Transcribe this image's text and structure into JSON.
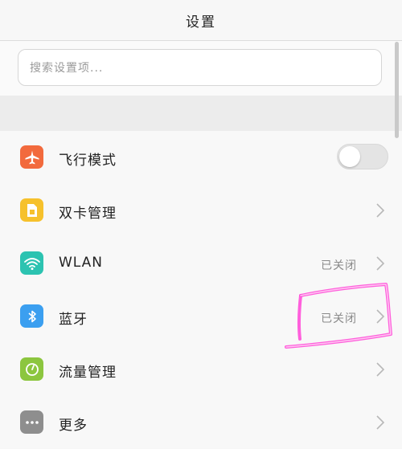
{
  "header": {
    "title": "设置"
  },
  "search": {
    "placeholder": "搜索设置项..."
  },
  "colors": {
    "airplane": "#f26a3d",
    "dual_sim": "#f6c12c",
    "wlan": "#2cc3b1",
    "bluetooth": "#3b9ff0",
    "data_usage": "#8cc63f",
    "more": "#8e8e8e",
    "annotation": "#ff4fd8"
  },
  "settings": {
    "items": [
      {
        "label": "飞行模式",
        "icon": "airplane-icon",
        "control": "toggle",
        "toggle_on": false
      },
      {
        "label": "双卡管理",
        "icon": "sim-card-icon",
        "control": "chevron"
      },
      {
        "label": "WLAN",
        "icon": "wifi-icon",
        "value": "已关闭",
        "control": "chevron"
      },
      {
        "label": "蓝牙",
        "icon": "bluetooth-icon",
        "value": "已关闭",
        "control": "chevron"
      },
      {
        "label": "流量管理",
        "icon": "data-usage-icon",
        "control": "chevron"
      },
      {
        "label": "更多",
        "icon": "more-dots-icon",
        "control": "chevron"
      }
    ]
  }
}
